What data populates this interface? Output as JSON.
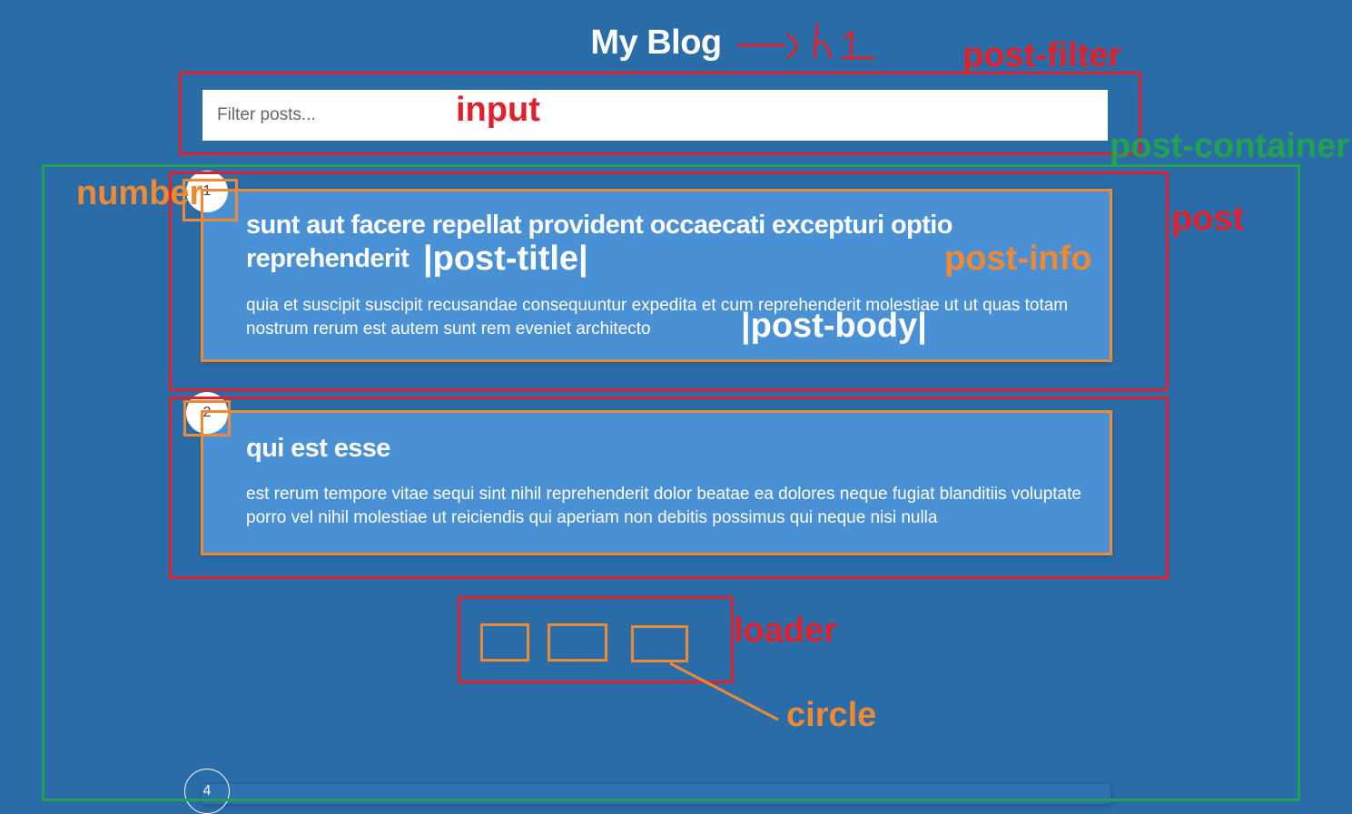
{
  "header": {
    "title": "My Blog"
  },
  "filter": {
    "placeholder": "Filter posts..."
  },
  "posts": [
    {
      "number": "1",
      "title": "sunt aut facere repellat provident occaecati excepturi optio reprehenderit",
      "body": "quia et suscipit suscipit recusandae consequuntur expedita et cum reprehenderit molestiae ut ut quas totam nostrum rerum est autem sunt rem eveniet architecto"
    },
    {
      "number": "2",
      "title": "qui est esse",
      "body": "est rerum tempore vitae sequi sint nihil reprehenderit dolor beatae ea dolores neque fugiat blanditiis voluptate porro vel nihil molestiae ut reiciendis qui aperiam non debitis possimus qui neque nisi nulla"
    },
    {
      "number": "4"
    }
  ],
  "annotations": {
    "h1": "h1",
    "post_filter": "post-filter",
    "input": "input",
    "post_container": "post-container",
    "number": "number",
    "post": "post",
    "post_title": "|post-title|",
    "post_info": "post-info",
    "post_body": "|post-body|",
    "loader": "loader",
    "circle": "circle"
  },
  "colors": {
    "background": "#2a6ca8",
    "card": "#4a90d4",
    "annotation_red": "#e0202a",
    "annotation_orange": "#f08a32",
    "annotation_green": "#22a150"
  }
}
